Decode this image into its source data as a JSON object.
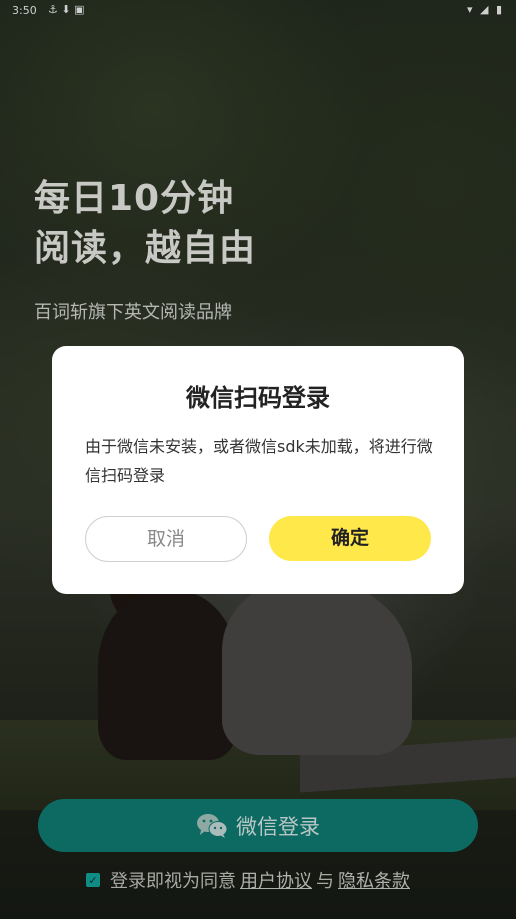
{
  "status_bar": {
    "time": "3:50",
    "left_icons": "⚓ ⬇ ▣",
    "right_icons": "▾ ◢ ▮"
  },
  "hero": {
    "title_line1": "每日10分钟",
    "title_line2": "阅读，越自由",
    "subtitle": "百词斩旗下英文阅读品牌"
  },
  "dialog": {
    "title": "微信扫码登录",
    "message": "由于微信未安装，或者微信sdk未加载，将进行微信扫码登录",
    "cancel_label": "取消",
    "confirm_label": "确定"
  },
  "login": {
    "wechat_label": "微信登录",
    "icon": "wechat-icon"
  },
  "agreement": {
    "checked": true,
    "prefix": "登录即视为同意",
    "user_agreement": "用户协议",
    "conjunction": "与",
    "privacy_policy": "隐私条款"
  },
  "colors": {
    "accent_yellow": "#ffe84a",
    "wechat_green": "#0d6a63",
    "checkbox_teal": "#0f8c84"
  }
}
